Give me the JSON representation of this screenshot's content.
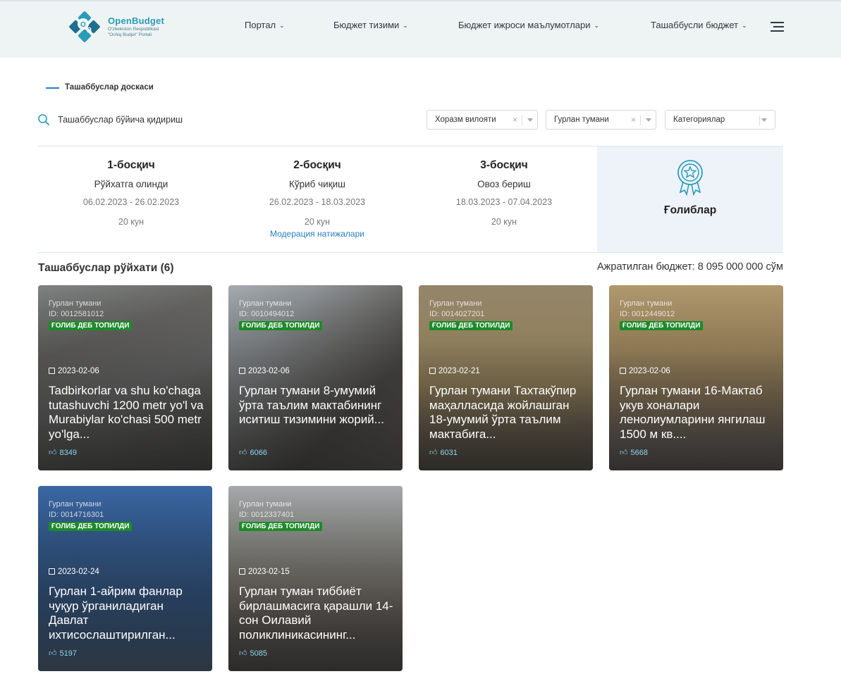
{
  "header": {
    "logo_title": "OpenBudget",
    "logo_sub1": "O'zbekiston Respublikasi",
    "logo_sub2": "\"Ochiq Budjet\" Portali",
    "nav": [
      "Портал",
      "Бюджет тизими",
      "Бюджет ижроси маълумотлари",
      "Ташаббусли бюджет"
    ]
  },
  "breadcrumb": "Ташаббуслар доскаси",
  "search": {
    "placeholder": "Ташаббуслар бўйича қидириш"
  },
  "filters": [
    {
      "value": "Хоразм вилояти",
      "clearable": true
    },
    {
      "value": "Гурлан тумани",
      "clearable": true
    },
    {
      "value": "Категориялар",
      "clearable": false
    }
  ],
  "stages": [
    {
      "title": "1-босқич",
      "name": "Рўйхатга олинди",
      "dates": "06.02.2023 - 26.02.2023",
      "days": "20 кун",
      "link": ""
    },
    {
      "title": "2-босқич",
      "name": "Кўриб чиқиш",
      "dates": "26.02.2023 - 18.03.2023",
      "days": "20 кун",
      "link": "Модерация натижалари"
    },
    {
      "title": "3-босқич",
      "name": "Овоз бериш",
      "dates": "18.03.2023 - 07.04.2023",
      "days": "20 кун",
      "link": ""
    }
  ],
  "winners_label": "Ғолиблар",
  "list": {
    "title": "Ташаббуслар рўйхати (6)",
    "budget": "Ажратилган бюджет: 8 095 000 000 сўм"
  },
  "badge_label": "ҒОЛИБ ДЕБ ТОПИЛДИ",
  "cards": [
    {
      "district": "Гурлан тумани",
      "id": "ID: 0012581012",
      "date": "2023-02-06",
      "title": "Tadbirkorlar va shu ko'chaga tutashuvchi 1200 metr yo'l va Murabiylar ko'chasi 500 metr yo'lga...",
      "likes": "8349"
    },
    {
      "district": "Гурлан тумани",
      "id": "ID: 0010494012",
      "date": "2023-02-06",
      "title": "Гурлан тумани 8-умумий ўрта таълим мактабининг иситиш тизимини жорий...",
      "likes": "6066"
    },
    {
      "district": "Гурлан тумани",
      "id": "ID: 0014027201",
      "date": "2023-02-21",
      "title": "Гурлан тумани Тахтакўпир маҳалласида жойлашган 18-умумий ўрта таълим мактабига...",
      "likes": "6031"
    },
    {
      "district": "Гурлан тумани",
      "id": "ID: 0012449012",
      "date": "2023-02-06",
      "title": "Гурлан тумани 16-Мактаб укув хоналари ленолиумларини янгилаш 1500 м кв....",
      "likes": "5668"
    },
    {
      "district": "Гурлан тумани",
      "id": "ID: 0014716301",
      "date": "2023-02-24",
      "title": "Гурлан 1-айрим фанлар чуқур ўрганиладиган Давлат ихтисослаштирилган...",
      "likes": "5197"
    },
    {
      "district": "Гурлан тумани",
      "id": "ID: 0012337401",
      "date": "2023-02-15",
      "title": "Гурлан туман тиббиёт бирлашмасига қарашли 14-сон Оилавий поликлиникасининг...",
      "likes": "5085"
    }
  ]
}
